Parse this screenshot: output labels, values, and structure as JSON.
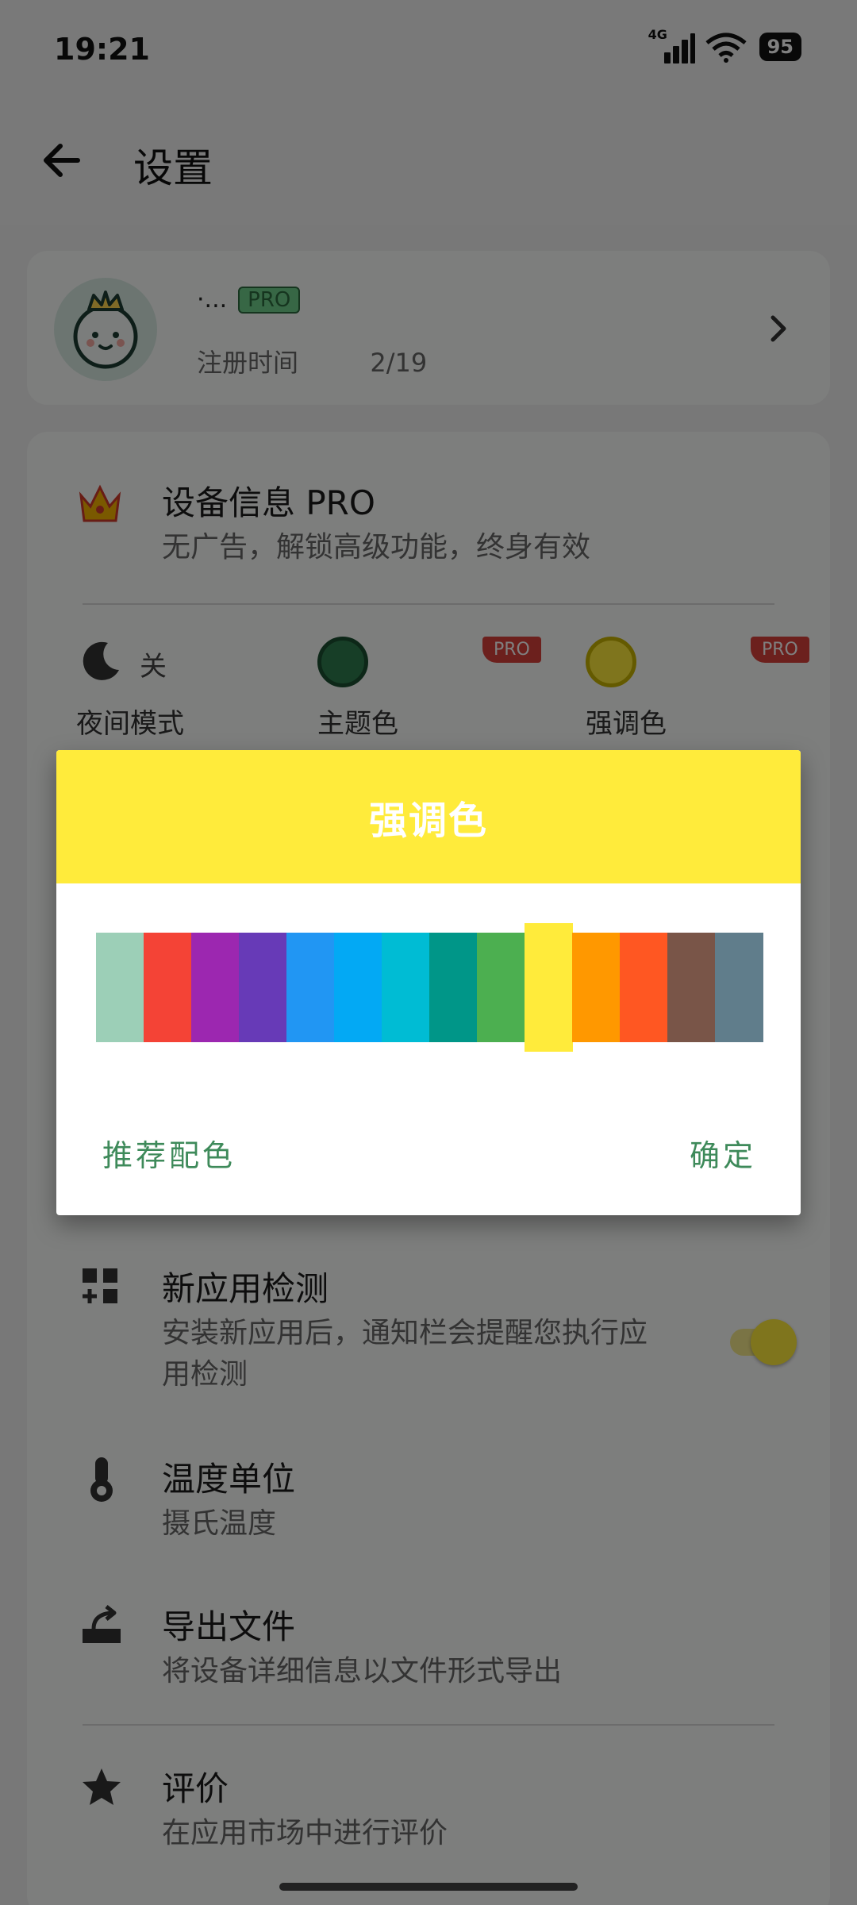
{
  "status_bar": {
    "time": "19:21",
    "network": "4G",
    "battery": "95"
  },
  "app_bar": {
    "title": "设置"
  },
  "profile": {
    "name": "·...",
    "badge": "PRO",
    "registered": "注册时间",
    "date": "2/19"
  },
  "pro_row": {
    "title": "设备信息 PRO",
    "subtitle": "无广告，解锁高级功能，终身有效"
  },
  "quick_settings": {
    "night_mode": {
      "label": "夜间模式",
      "value": "关"
    },
    "theme_color": {
      "label": "主题色",
      "badge": "PRO",
      "color": "#2e7d4f"
    },
    "accent_color": {
      "label": "强调色",
      "badge": "PRO",
      "color": "#ffeb3b"
    }
  },
  "rows": [
    {
      "title": "新应用检测",
      "subtitle": "安装新应用后，通知栏会提醒您执行应用检测",
      "toggle": true
    },
    {
      "title": "温度单位",
      "subtitle": "摄氏温度"
    },
    {
      "title": "导出文件",
      "subtitle": "将设备详细信息以文件形式导出"
    },
    {
      "title": "评价",
      "subtitle": "在应用市场中进行评价"
    }
  ],
  "dialog": {
    "title": "强调色",
    "selected_index": 9,
    "colors": [
      "#9ccfb7",
      "#f44336",
      "#9c27b0",
      "#673ab7",
      "#2196f3",
      "#03a9f4",
      "#00bcd4",
      "#009688",
      "#4caf50",
      "#ffeb3b",
      "#ff9800",
      "#ff5722",
      "#795548",
      "#607d8b"
    ],
    "neutral_button": "推荐配色",
    "positive_button": "确定"
  }
}
